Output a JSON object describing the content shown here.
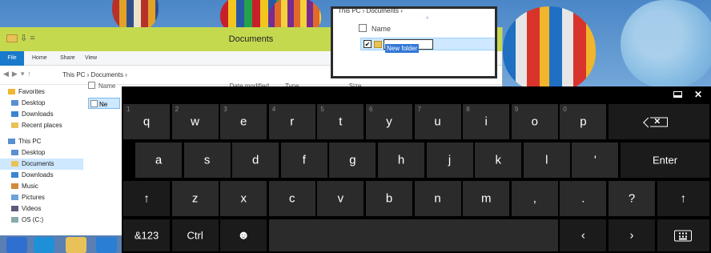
{
  "explorer": {
    "title": "Documents",
    "ribbon_tabs": [
      "File",
      "Home",
      "Share",
      "View"
    ],
    "address": "This PC  ›  Documents  ›",
    "column_name": "Name",
    "column_date": "Date modified",
    "column_type": "Type",
    "column_size": "Size",
    "row_label": "Ne",
    "nav": [
      {
        "label": "Favorites",
        "icon": "star-icon",
        "sub": false
      },
      {
        "label": "Desktop",
        "icon": "desktop-icon",
        "sub": true
      },
      {
        "label": "Downloads",
        "icon": "downloads-icon",
        "sub": true
      },
      {
        "label": "Recent places",
        "icon": "recent-places-icon",
        "sub": true
      },
      {
        "label": "This PC",
        "icon": "pc-icon",
        "sub": false
      },
      {
        "label": "Desktop",
        "icon": "desktop-icon",
        "sub": true
      },
      {
        "label": "Documents",
        "icon": "documents-icon",
        "sub": true,
        "selected": true
      },
      {
        "label": "Downloads",
        "icon": "downloads-icon",
        "sub": true
      },
      {
        "label": "Music",
        "icon": "music-icon",
        "sub": true
      },
      {
        "label": "Pictures",
        "icon": "pictures-icon",
        "sub": true
      },
      {
        "label": "Videos",
        "icon": "videos-icon",
        "sub": true
      },
      {
        "label": "OS (C:)",
        "icon": "drive-icon",
        "sub": true
      }
    ]
  },
  "popup": {
    "breadcrumb": "This PC  ›  Documents  ›",
    "column_name": "Name",
    "rename_value": "New folder"
  },
  "keyboard": {
    "row1": [
      {
        "label": "q",
        "num": "1"
      },
      {
        "label": "w",
        "num": "2"
      },
      {
        "label": "e",
        "num": "3"
      },
      {
        "label": "r",
        "num": "4"
      },
      {
        "label": "t",
        "num": "5"
      },
      {
        "label": "y",
        "num": "6"
      },
      {
        "label": "u",
        "num": "7"
      },
      {
        "label": "i",
        "num": "8"
      },
      {
        "label": "o",
        "num": "9"
      },
      {
        "label": "p",
        "num": "0"
      }
    ],
    "row2": [
      "a",
      "s",
      "d",
      "f",
      "g",
      "h",
      "j",
      "k",
      "l",
      "'"
    ],
    "row3": [
      "z",
      "x",
      "c",
      "v",
      "b",
      "n",
      "m",
      ",",
      ".",
      "?"
    ],
    "enter": "Enter",
    "symbols": "&123",
    "ctrl": "Ctrl",
    "shift_glyph": "↑",
    "emoji_glyph": "☻",
    "left_glyph": "‹",
    "right_glyph": "›",
    "close_glyph": "✕"
  }
}
